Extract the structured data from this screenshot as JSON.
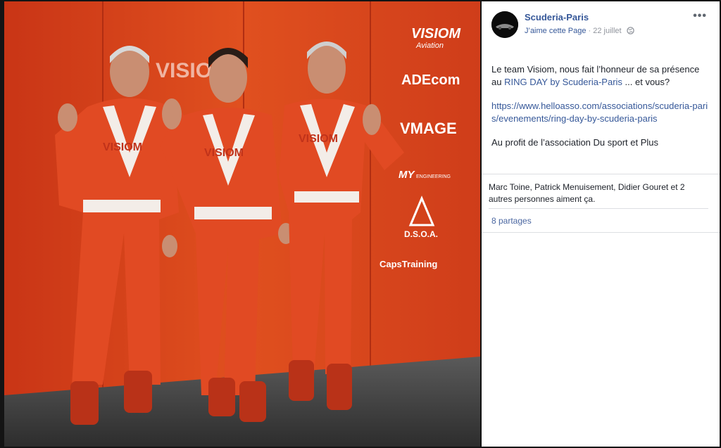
{
  "post": {
    "page_name": "Scuderia-Paris",
    "like_page": "J’aime cette Page",
    "dot": "·",
    "date": "22 juillet",
    "more": "•••",
    "text_line1": "Le team Visiom, nous fait l’honneur de sa présence au ",
    "event_link": "RING DAY by Scuderia-Paris",
    "text_line1_end": " ... et vous?",
    "url": "https://www.helloasso.com/associations/scuderia-paris/evenements/ring-day-by-scuderia-paris",
    "text_line3": "Au profit de l’association Du sport et Plus",
    "likes": "Marc Toine, Patrick Menuisement, Didier Gouret et 2 autres personnes aiment ça.",
    "shares": "8 partages"
  },
  "photo": {
    "logos": [
      "VISIOM",
      "Aviation",
      "ADEcom",
      "VMAGE",
      "MY",
      "ENGINEERING",
      "D.S.O.A.",
      "CapsTraining"
    ],
    "backdrop_text": "VISIOM",
    "suit_logo": "VISIOM"
  },
  "colors": {
    "link": "#365899",
    "text": "#1d2129",
    "meta": "#90949c",
    "backdrop": "#d9411f",
    "suit": "#e04a22"
  }
}
